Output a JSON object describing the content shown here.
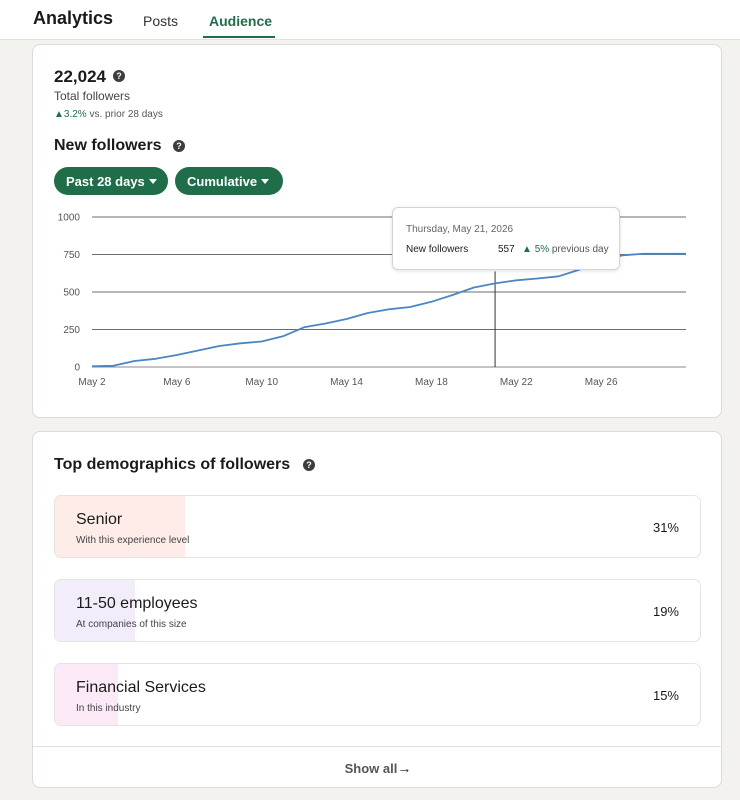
{
  "header": {
    "app_title": "Analytics",
    "tabs": [
      {
        "label": "Posts",
        "active": false
      },
      {
        "label": "Audience",
        "active": true
      }
    ],
    "accent_color": "#1f6e49"
  },
  "followers": {
    "total_value": "22,024",
    "total_label": "Total followers",
    "trend_arrow": "▲",
    "trend_pct": "3.2%",
    "trend_suffix": " vs. prior 28 days",
    "help_icon": "question-circle-icon"
  },
  "new_followers": {
    "title": "New followers",
    "range_label": "Past 28 days",
    "mode_label": "Cumulative"
  },
  "tooltip": {
    "date": "Thursday, May 21, 2026",
    "label": "New followers",
    "value": "557",
    "arrow": "▲",
    "change_pct": "5%",
    "change_suffix": " previous day"
  },
  "chart_data": {
    "type": "line",
    "title": "",
    "xlabel": "",
    "ylabel": "",
    "ylim": [
      0,
      1000
    ],
    "yticks": [
      "0",
      "250",
      "500",
      "750",
      "1000"
    ],
    "xticks": [
      "May 2",
      "May 6",
      "May 10",
      "May 14",
      "May 18",
      "May 22",
      "May 26"
    ],
    "grid": true,
    "series": [
      {
        "x": [
          2,
          3,
          4,
          5,
          6,
          7,
          8,
          9,
          10,
          11,
          12,
          13,
          14,
          15,
          16,
          17,
          18,
          19,
          20,
          21,
          22,
          23,
          24,
          25,
          26,
          27,
          28,
          29,
          30
        ],
        "values": [
          5,
          8,
          40,
          55,
          80,
          110,
          140,
          158,
          170,
          205,
          265,
          290,
          320,
          360,
          385,
          400,
          435,
          480,
          530,
          557,
          578,
          590,
          605,
          650,
          700,
          745,
          755,
          755,
          755
        ]
      }
    ],
    "color": "#4a86c5"
  },
  "demographics": {
    "title": "Top demographics of followers",
    "items": [
      {
        "label": "Senior",
        "sub": "With this experience level",
        "pct_text": "31%",
        "pct": 31,
        "color": "#fdece8"
      },
      {
        "label": "11-50 employees",
        "sub": "At companies of this size",
        "pct_text": "19%",
        "pct": 19,
        "color": "#f3ecfb"
      },
      {
        "label": "Financial Services",
        "sub": "In this industry",
        "pct_text": "15%",
        "pct": 15,
        "color": "#fbe9f7"
      }
    ],
    "show_all_label": "Show all",
    "show_all_arrow": "→"
  }
}
